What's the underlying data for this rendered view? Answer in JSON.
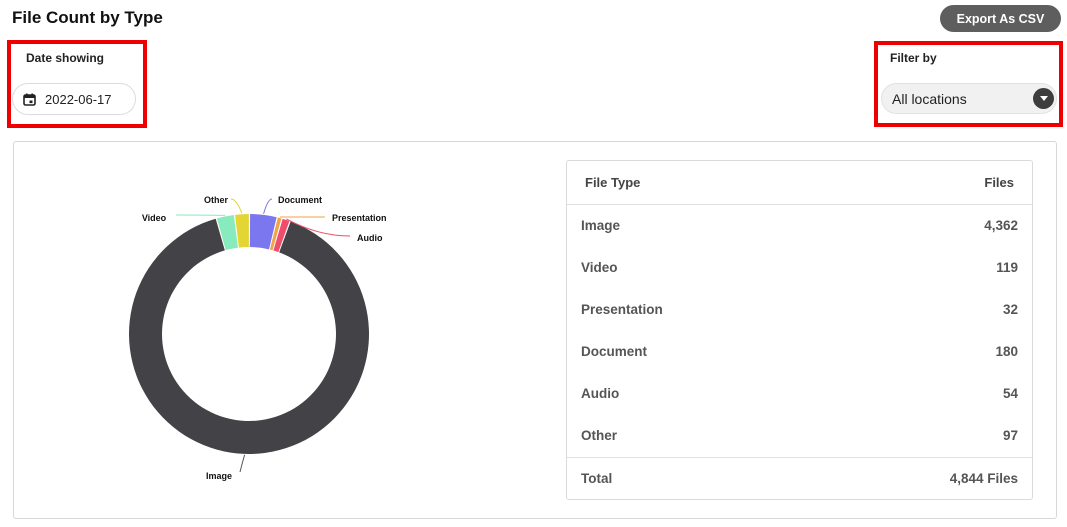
{
  "header": {
    "title": "File Count by Type",
    "export_label": "Export As CSV"
  },
  "date_control": {
    "label": "Date showing",
    "value": "2022-06-17",
    "icon": "calendar-icon"
  },
  "filter_control": {
    "label": "Filter by",
    "selected": "All locations",
    "icon": "caret-down-icon"
  },
  "colors": {
    "accent_button": "#5e5e5e",
    "highlight_box": "#ee0000"
  },
  "chart_data": {
    "type": "pie",
    "variant": "donut",
    "slices": [
      {
        "label": "Image",
        "value": 4362,
        "color": "#434246"
      },
      {
        "label": "Video",
        "value": 119,
        "color": "#87ebbd"
      },
      {
        "label": "Other",
        "value": 97,
        "color": "#e2d534"
      },
      {
        "label": "Document",
        "value": 180,
        "color": "#7b77ee"
      },
      {
        "label": "Presentation",
        "value": 32,
        "color": "#f2a24a"
      },
      {
        "label": "Audio",
        "value": 54,
        "color": "#ef4d6c"
      }
    ]
  },
  "table": {
    "headers": {
      "type": "File Type",
      "files": "Files"
    },
    "rows": [
      {
        "type": "Image",
        "files": "4,362"
      },
      {
        "type": "Video",
        "files": "119"
      },
      {
        "type": "Presentation",
        "files": "32"
      },
      {
        "type": "Document",
        "files": "180"
      },
      {
        "type": "Audio",
        "files": "54"
      },
      {
        "type": "Other",
        "files": "97"
      }
    ],
    "total": {
      "label": "Total",
      "value": "4,844 Files"
    }
  }
}
